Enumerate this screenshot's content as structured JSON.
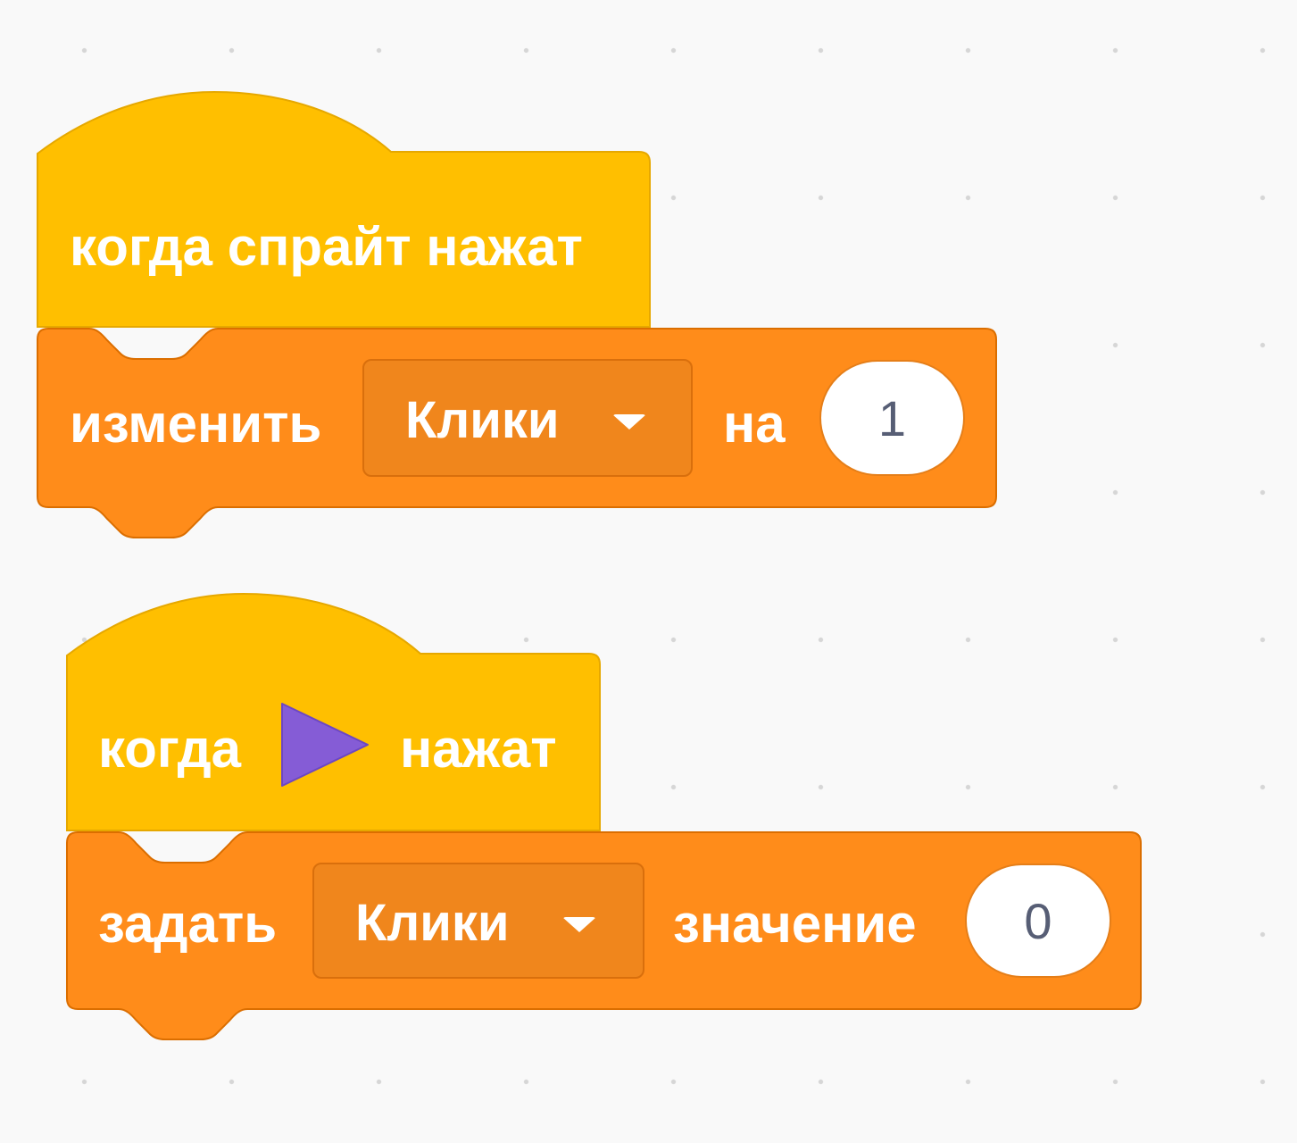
{
  "script1": {
    "hat_label": "когда спрайт нажат",
    "change_label": "изменить",
    "variable": "Клики",
    "by_label": "на",
    "amount": "1"
  },
  "script2": {
    "hat_label_before": "когда",
    "hat_label_after": "нажат",
    "set_label": "задать",
    "variable": "Клики",
    "value_label": "значение",
    "value": "0"
  },
  "colors": {
    "events_block": "#ffbf00",
    "events_border": "#e6a800",
    "variables_block": "#ff8c1a",
    "variables_border": "#db6e00",
    "flag": "#855cd6"
  },
  "icons": {
    "green_flag": "play-triangle-icon",
    "dropdown_arrow": "caret-down-icon"
  }
}
